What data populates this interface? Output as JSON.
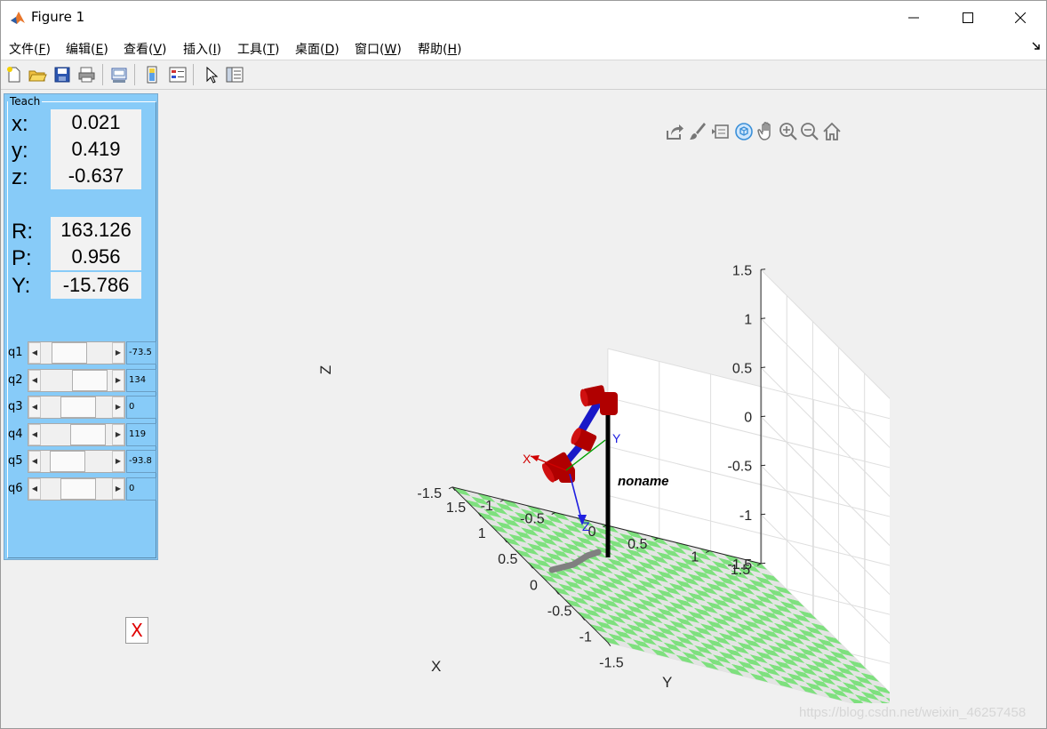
{
  "window": {
    "title": "Figure 1"
  },
  "menu": [
    {
      "label": "文件(",
      "key": "F",
      "suffix": ")"
    },
    {
      "label": "编辑(",
      "key": "E",
      "suffix": ")"
    },
    {
      "label": "查看(",
      "key": "V",
      "suffix": ")"
    },
    {
      "label": "插入(",
      "key": "I",
      "suffix": ")"
    },
    {
      "label": "工具(",
      "key": "T",
      "suffix": ")"
    },
    {
      "label": "桌面(",
      "key": "D",
      "suffix": ")"
    },
    {
      "label": "窗口(",
      "key": "W",
      "suffix": ")"
    },
    {
      "label": "帮助(",
      "key": "H",
      "suffix": ")"
    }
  ],
  "teach": {
    "legend": "Teach",
    "position": [
      {
        "label": "x:",
        "value": "0.021"
      },
      {
        "label": "y:",
        "value": "0.419"
      },
      {
        "label": "z:",
        "value": "-0.637"
      }
    ],
    "orientation": [
      {
        "label": "R:",
        "value": "163.126"
      },
      {
        "label": "P:",
        "value": "0.956"
      },
      {
        "label": "Y:",
        "value": "-15.786"
      }
    ],
    "joints": [
      {
        "name": "q1",
        "value": "-73.5",
        "fraction": 0.3
      },
      {
        "name": "q2",
        "value": "134",
        "fraction": 0.87
      },
      {
        "name": "q3",
        "value": "0",
        "fraction": 0.55
      },
      {
        "name": "q4",
        "value": "119",
        "fraction": 0.83
      },
      {
        "name": "q5",
        "value": "-93.8",
        "fraction": 0.24
      },
      {
        "name": "q6",
        "value": "0",
        "fraction": 0.55
      }
    ],
    "close_label": "X"
  },
  "plot": {
    "z_label": "Z",
    "x_label": "X",
    "y_label": "Y",
    "z_ticks": [
      "1.5",
      "1",
      "0.5",
      "0",
      "-0.5",
      "-1",
      "-1.5"
    ],
    "x_ticks": [
      "1.5",
      "1",
      "0.5",
      "0",
      "-0.5",
      "-1",
      "-1.5"
    ],
    "y_ticks": [
      "1.5",
      "1",
      "0.5",
      "0",
      "-0.5",
      "-1",
      "-1.5"
    ],
    "robot_name": "noname",
    "frame_labels": {
      "x": "X",
      "y": "Y",
      "z": "Z"
    },
    "floor_colors": [
      "#7ee07e",
      "#e4e4e4"
    ],
    "link_color": "#1818c8",
    "joint_color": "#b00000",
    "base_color": "#000000",
    "shadow_color": "#808080"
  },
  "watermark": "https://blog.csdn.net/weixin_46257458"
}
